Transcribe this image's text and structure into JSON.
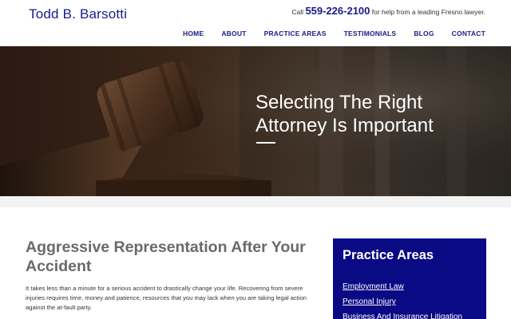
{
  "header": {
    "site_title": "Todd B. Barsotti",
    "call_prefix": "Call",
    "phone": "559-226-2100",
    "call_suffix": "for help from a leading Fresno lawyer."
  },
  "nav": {
    "items": [
      "HOME",
      "ABOUT",
      "PRACTICE AREAS",
      "TESTIMONIALS",
      "BLOG",
      "CONTACT"
    ]
  },
  "hero": {
    "title": "Selecting The Right Attorney Is Important"
  },
  "main": {
    "heading": "Aggressive Representation After Your Accident",
    "body": "It takes less than a minute for a serious accident to drastically change your life. Recovering from severe injuries requires time, money and patience, resources that you may lack when you are taking legal action against the at-fault party."
  },
  "sidebar": {
    "title": "Practice Areas",
    "links": [
      "Employment Law",
      "Personal Injury",
      "Business And Insurance Litigation"
    ]
  },
  "colors": {
    "brand_blue": "#1a1a8c",
    "sidebar_bg": "#0a0a85"
  }
}
